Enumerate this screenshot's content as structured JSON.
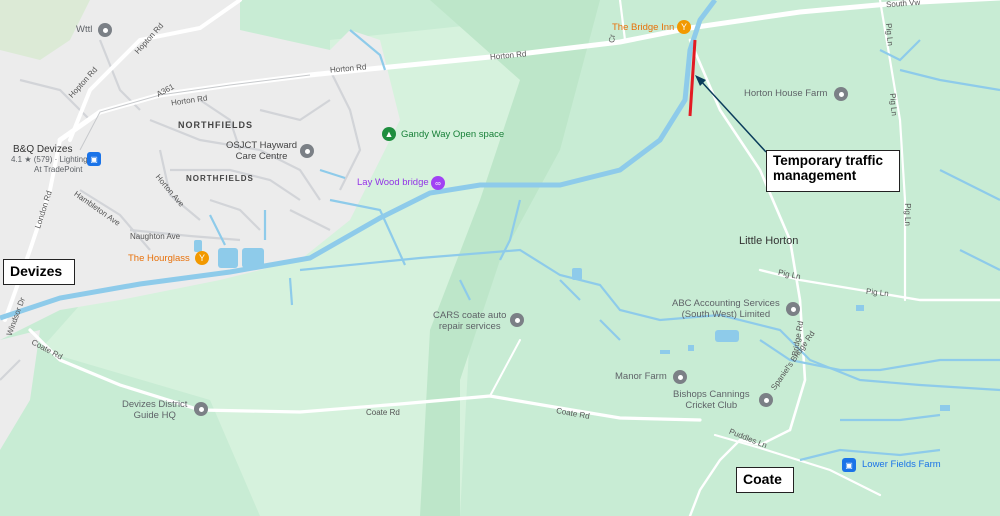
{
  "areas": {
    "northfields_upper": "NORTHFIELDS",
    "northfields_lower": "NORTHFIELDS"
  },
  "roads": {
    "horton_rd_1": "Horton Rd",
    "horton_rd_2": "Horton Rd",
    "horton_rd_3": "Horton Rd",
    "hopton_rd_1": "Hopton Rd",
    "hopton_rd_2": "Hopton Rd",
    "a361": "A361",
    "horton_ave": "Horton Ave",
    "hambleton_ave": "Hambleton Ave",
    "naughton_ave": "Naughton Ave",
    "london_rd": "London Rd",
    "windsor_dr": "Windsor Dr",
    "coate_rd_1": "Coate Rd",
    "coate_rd_2": "Coate Rd",
    "coate_rd_3": "Coate Rd",
    "south_vw": "South Vw",
    "pig_ln_1": "Pig Ln",
    "pig_ln_2": "Pig Ln",
    "pig_ln_3": "Pig Ln",
    "pig_ln_4": "Pig Ln",
    "pig_ln_5": "Pig Ln",
    "bridge_rd": "Bridge Rd",
    "spaniels_bridge_rd": "Spaniel's Bridge Rd",
    "puddles_ln": "Puddles Ln",
    "crs": "Cr"
  },
  "pois": {
    "wttl": "Wttl",
    "bq_devizes": "B&Q Devizes",
    "bq_rating": "4.1 ★ (579) · Lighting",
    "bq_sub": "At TradePoint",
    "osjct_1": "OSJCT Hayward",
    "osjct_2": "Care Centre",
    "gandy_way": "Gandy Way Open space",
    "lay_wood": "Lay Wood bridge",
    "hourglass": "The Hourglass",
    "bridge_inn": "The Bridge Inn",
    "horton_house": "Horton House Farm",
    "little_horton": "Little Horton",
    "abc_1": "ABC Accounting Services",
    "abc_2": "(South West) Limited",
    "cars_1": "CARS coate auto",
    "cars_2": "repair services",
    "manor_farm": "Manor Farm",
    "bishops_1": "Bishops Cannings",
    "bishops_2": "Cricket Club",
    "devizes_guide_1": "Devizes District",
    "devizes_guide_2": "Guide HQ",
    "lower_fields": "Lower Fields Farm"
  },
  "callouts": {
    "devizes": "Devizes",
    "coate": "Coate",
    "ttm_line1": "Temporary traffic",
    "ttm_line2": "management"
  },
  "colors": {
    "water": "#8ecbea",
    "closure": "#e31b23",
    "arrow": "#0b3d5c",
    "urban": "#ececec",
    "field": "#c8ecd4"
  },
  "icons": {
    "pub": "cocktail-glass-icon",
    "place": "location-pin-icon",
    "shop": "shopping-bag-icon",
    "park": "tree-icon",
    "bridge": "bridge-icon"
  }
}
